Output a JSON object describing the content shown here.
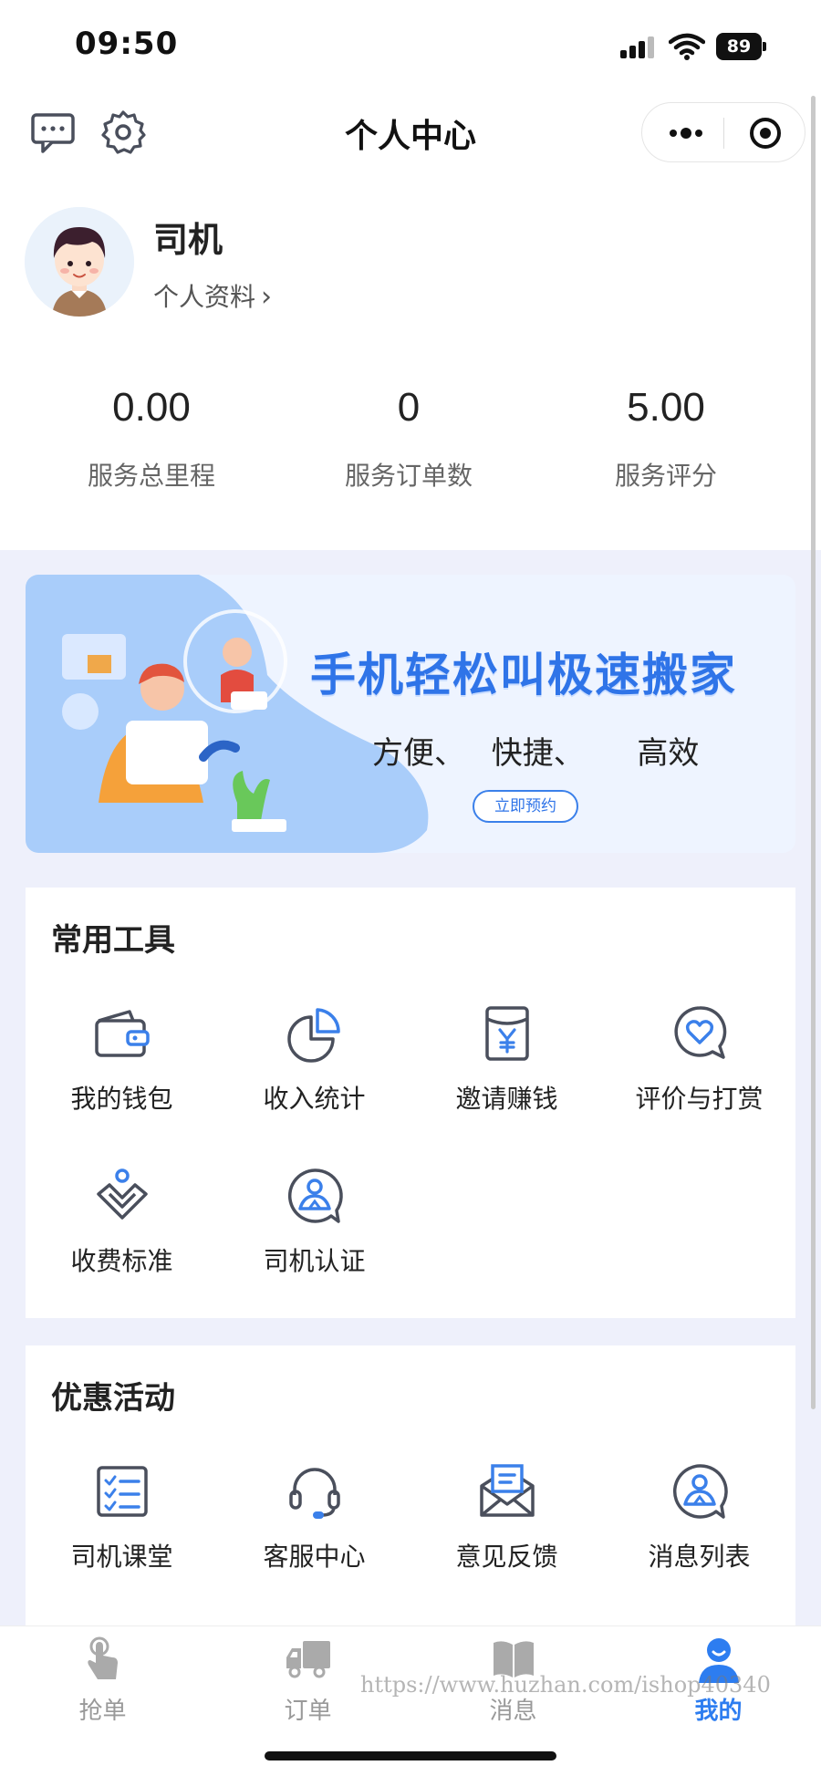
{
  "status_bar": {
    "time": "09:50",
    "battery": "89"
  },
  "nav": {
    "title": "个人中心",
    "icons": [
      "message-icon",
      "gear-icon",
      "more-icon",
      "target-icon"
    ]
  },
  "profile": {
    "name": "司机",
    "link_label": "个人资料",
    "stats": [
      {
        "value": "0.00",
        "label": "服务总里程"
      },
      {
        "value": "0",
        "label": "服务订单数"
      },
      {
        "value": "5.00",
        "label": "服务评分"
      }
    ]
  },
  "banner": {
    "headline": "手机轻松叫极速搬家",
    "subline": "方便、 快捷、  高效",
    "button": "立即预约"
  },
  "tools": {
    "title": "常用工具",
    "items": [
      {
        "label": "我的钱包",
        "icon": "wallet-icon"
      },
      {
        "label": "收入统计",
        "icon": "pie-chart-icon"
      },
      {
        "label": "邀请赚钱",
        "icon": "yen-envelope-icon"
      },
      {
        "label": "评价与打赏",
        "icon": "heart-bubble-icon"
      },
      {
        "label": "收费标准",
        "icon": "pricing-icon"
      },
      {
        "label": "司机认证",
        "icon": "driver-badge-icon"
      }
    ]
  },
  "promotions": {
    "title": "优惠活动",
    "items": [
      {
        "label": "司机课堂",
        "icon": "checklist-icon"
      },
      {
        "label": "客服中心",
        "icon": "headset-icon"
      },
      {
        "label": "意见反馈",
        "icon": "mail-icon"
      },
      {
        "label": "消息列表",
        "icon": "person-badge-icon"
      }
    ]
  },
  "tabbar": {
    "items": [
      {
        "label": "抢单",
        "icon": "tap-hand-icon",
        "active": false
      },
      {
        "label": "订单",
        "icon": "truck-icon",
        "active": false
      },
      {
        "label": "消息",
        "icon": "book-icon",
        "active": false
      },
      {
        "label": "我的",
        "icon": "user-icon",
        "active": true
      }
    ],
    "watermark": "https://www.huzhan.com/ishop40340"
  },
  "colors": {
    "accent": "#2d7df0",
    "icon_stroke": "#4a4f5c",
    "icon_accent": "#3b80ea",
    "page_bg": "#eef0fb"
  }
}
